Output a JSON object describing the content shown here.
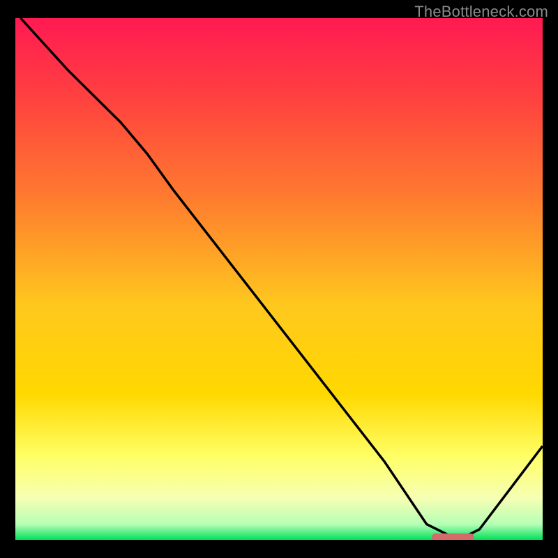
{
  "watermark": "TheBottleneck.com",
  "chart_data": {
    "type": "line",
    "title": "",
    "xlabel": "",
    "ylabel": "",
    "xlim": [
      0,
      100
    ],
    "ylim": [
      0,
      100
    ],
    "legend": false,
    "grid": false,
    "gradient": {
      "top_color": "#ff1a52",
      "mid_upper_color": "#ff7d2e",
      "mid_color": "#ffd800",
      "lower_mid_color": "#ffff66",
      "lower_color": "#f6ffb3",
      "bottom_color": "#00e05a"
    },
    "curve": {
      "description": "Bottleneck curve: starts at top-left, descends steeply to a minimum near x≈80-85, then rises again toward the right edge.",
      "x": [
        1,
        10,
        20,
        25,
        30,
        40,
        50,
        60,
        70,
        78,
        84,
        88,
        100
      ],
      "y": [
        100,
        90,
        80,
        74,
        67,
        54,
        41,
        28,
        15,
        3,
        0,
        2,
        18
      ]
    },
    "optimal_marker": {
      "x_start": 79,
      "x_end": 87,
      "y": 0.5,
      "color": "#d46a6a"
    }
  }
}
